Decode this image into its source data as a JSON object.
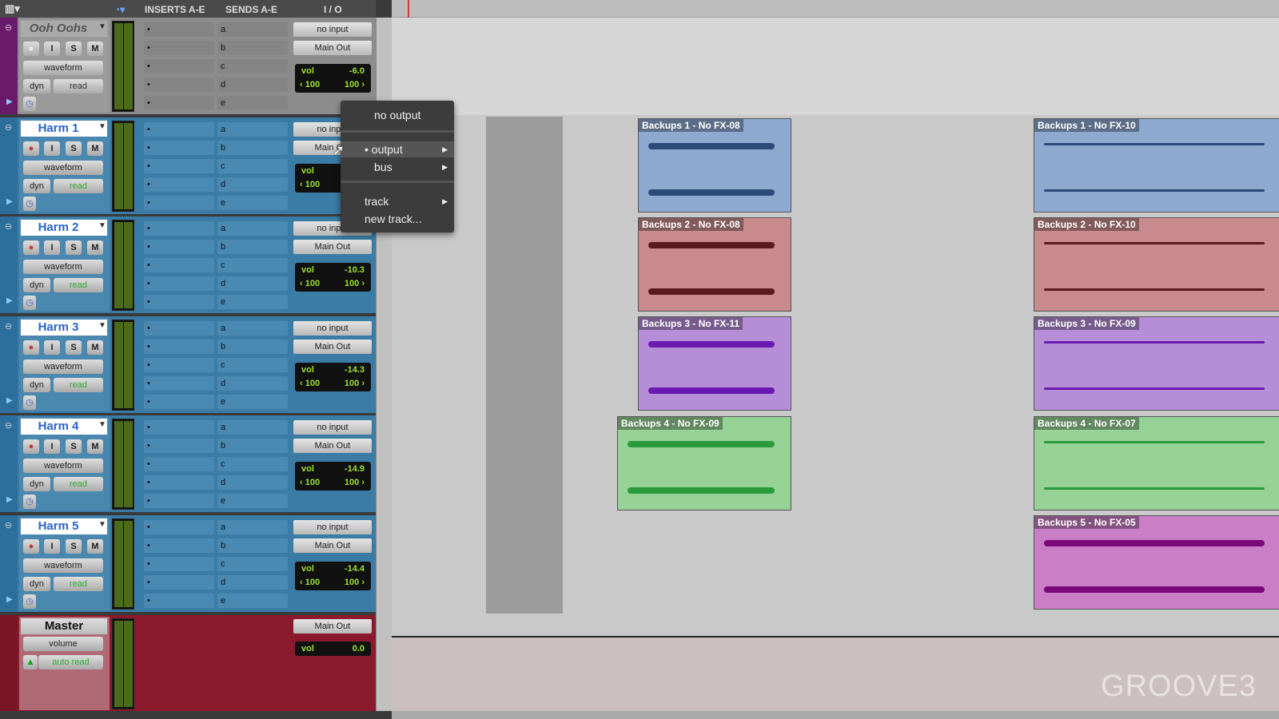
{
  "header": {
    "inserts": "INSERTS A-E",
    "sends": "SENDS A-E",
    "io": "I / O"
  },
  "tracks": [
    {
      "name": "Ooh Oohs",
      "strip": "#6a1a6a",
      "bg": "#8c8c8c",
      "input": "no input",
      "output": "Main Out",
      "view": "waveform",
      "dyn": "dyn",
      "auto": "read",
      "vol_label": "vol",
      "vol": "-6.0",
      "pan_l": "‹ 100",
      "pan_r": "100 ›"
    },
    {
      "name": "Harm 1",
      "strip": "#2d6f9c",
      "bg": "#3b7ca6",
      "input": "no input",
      "output": "Main Out",
      "view": "waveform",
      "dyn": "dyn",
      "auto": "read",
      "vol_label": "vol",
      "vol": "",
      "pan_l": "‹ 100",
      "pan_r": ""
    },
    {
      "name": "Harm 2",
      "strip": "#2d6f9c",
      "bg": "#3b7ca6",
      "input": "no input",
      "output": "Main Out",
      "view": "waveform",
      "dyn": "dyn",
      "auto": "read",
      "vol_label": "vol",
      "vol": "-10.3",
      "pan_l": "‹ 100",
      "pan_r": "100 ›"
    },
    {
      "name": "Harm 3",
      "strip": "#2d6f9c",
      "bg": "#3b7ca6",
      "input": "no input",
      "output": "Main Out",
      "view": "waveform",
      "dyn": "dyn",
      "auto": "read",
      "vol_label": "vol",
      "vol": "-14.3",
      "pan_l": "‹ 100",
      "pan_r": "100 ›"
    },
    {
      "name": "Harm 4",
      "strip": "#2d6f9c",
      "bg": "#3b7ca6",
      "input": "no input",
      "output": "Main Out",
      "view": "waveform",
      "dyn": "dyn",
      "auto": "read",
      "vol_label": "vol",
      "vol": "-14.9",
      "pan_l": "‹ 100",
      "pan_r": "100 ›"
    },
    {
      "name": "Harm 5",
      "strip": "#2d6f9c",
      "bg": "#3b7ca6",
      "input": "no input",
      "output": "Main Out",
      "view": "waveform",
      "dyn": "dyn",
      "auto": "read",
      "vol_label": "vol",
      "vol": "-14.4",
      "pan_l": "‹ 100",
      "pan_r": "100 ›"
    }
  ],
  "buttons": {
    "rec": "●",
    "input": "I",
    "solo": "S",
    "mute": "M"
  },
  "sends": [
    "a",
    "b",
    "c",
    "d",
    "e"
  ],
  "master": {
    "name": "Master",
    "view": "volume",
    "auto": "auto read",
    "output": "Main Out",
    "vol_label": "vol",
    "vol": "0.0"
  },
  "menu": {
    "no_output": "no output",
    "output": "• output",
    "bus": "bus",
    "track": "track",
    "new_track": "new track..."
  },
  "clips": [
    {
      "name": "Backups 1 - No FX-08",
      "color": "#8ea9cf",
      "wave": "#2a4a7a"
    },
    {
      "name": "Backups 1 - No FX-10",
      "color": "#8ea9cf",
      "wave": "#2a4a7a"
    },
    {
      "name": "Backups 2 - No FX-08",
      "color": "#c88a8c",
      "wave": "#5a1a1e"
    },
    {
      "name": "Backups 2 - No FX-10",
      "color": "#c88a8c",
      "wave": "#5a1a1e"
    },
    {
      "name": "Backups 3 - No FX-11",
      "color": "#b68ed8",
      "wave": "#6a1ab0"
    },
    {
      "name": "Backups 3 - No FX-09",
      "color": "#b68ed8",
      "wave": "#6a1ab0"
    },
    {
      "name": "Backups 4 - No FX-09",
      "color": "#96d196",
      "wave": "#2a9a3a"
    },
    {
      "name": "Backups 4 - No FX-07",
      "color": "#96d196",
      "wave": "#2a9a3a"
    },
    {
      "name": "Backups 5 - No FX-05",
      "color": "#c97ec6",
      "wave": "#7a0a7a"
    }
  ],
  "watermark": "GROOVE3"
}
